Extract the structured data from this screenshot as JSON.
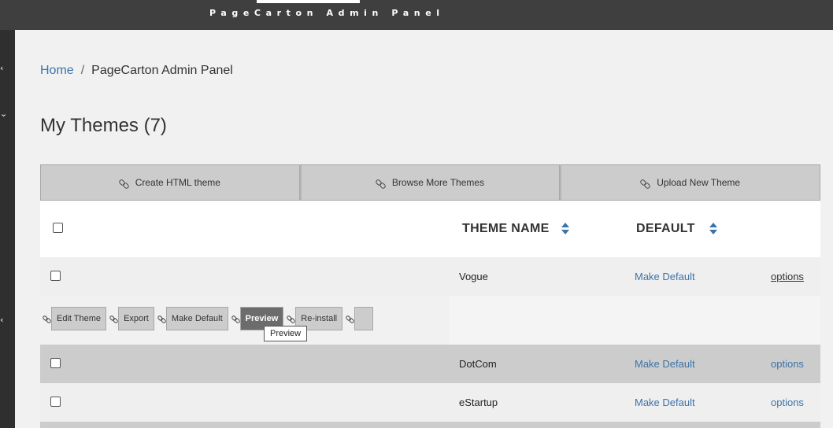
{
  "app": {
    "title": "PageCarton Admin Panel"
  },
  "breadcrumb": {
    "home": "Home",
    "separator": "/",
    "current": "PageCarton Admin Panel"
  },
  "page": {
    "title": "My Themes (7)"
  },
  "actions": [
    {
      "label": "Create HTML theme",
      "icon": "link-icon"
    },
    {
      "label": "Browse More Themes",
      "icon": "link-icon"
    },
    {
      "label": "Upload New Theme",
      "icon": "link-icon"
    }
  ],
  "table": {
    "columns": {
      "name": "THEME NAME",
      "default": "DEFAULT"
    },
    "rows": [
      {
        "name": "Vogue",
        "default_action": "Make Default",
        "options": "options"
      },
      {
        "name": "DotCom",
        "default_action": "Make Default",
        "options": "options"
      },
      {
        "name": "eStartup",
        "default_action": "Make Default",
        "options": "options"
      }
    ],
    "row_options": {
      "buttons": [
        "Edit Theme",
        "Export",
        "Make Default",
        "Preview",
        "Re-install"
      ],
      "tooltip": "Preview"
    }
  },
  "colors": {
    "topbar": "#3f3f3f",
    "accent": "#3c73a8",
    "button": "#cccccc"
  }
}
